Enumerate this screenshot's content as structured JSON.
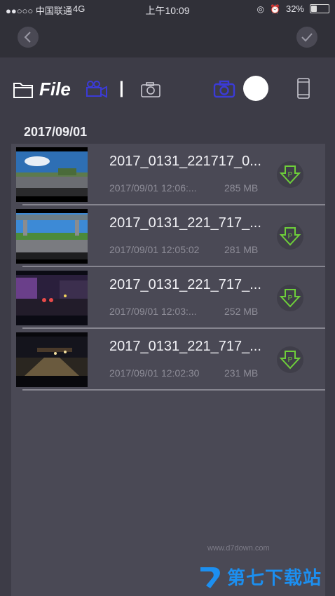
{
  "status": {
    "carrier": "●●○○○ 中国联通",
    "network": "4G",
    "time": "上午10:09",
    "battery": "32%",
    "battery_level": 0.32
  },
  "nav": {
    "back_icon": "chevron-left-icon",
    "confirm_icon": "check-icon"
  },
  "toolbar": {
    "title": "File",
    "video_tab_icon": "video-camera-icon",
    "divider": "|",
    "photo_tab_icon": "camera-icon",
    "camera_icon": "camera-icon",
    "toggle_state": "on",
    "phone_icon": "phone-icon",
    "accent_color": "#3b3bd6"
  },
  "date_header": "2017/09/01",
  "files": [
    {
      "name": "2017_0131_221717_0...",
      "datetime": "2017/09/01 12:06:...",
      "size": "285 MB"
    },
    {
      "name": "2017_0131_221_717_...",
      "datetime": "2017/09/01 12:05:02",
      "size": "281 MB"
    },
    {
      "name": "2017_0131_221_717_...",
      "datetime": "2017/09/01 12:03:...",
      "size": "252 MB"
    },
    {
      "name": "2017_0131_221_717_...",
      "datetime": "2017/09/01 12:02:30",
      "size": "231 MB"
    }
  ],
  "watermark": {
    "text": "第七下载站",
    "url": "www.d7down.com"
  }
}
